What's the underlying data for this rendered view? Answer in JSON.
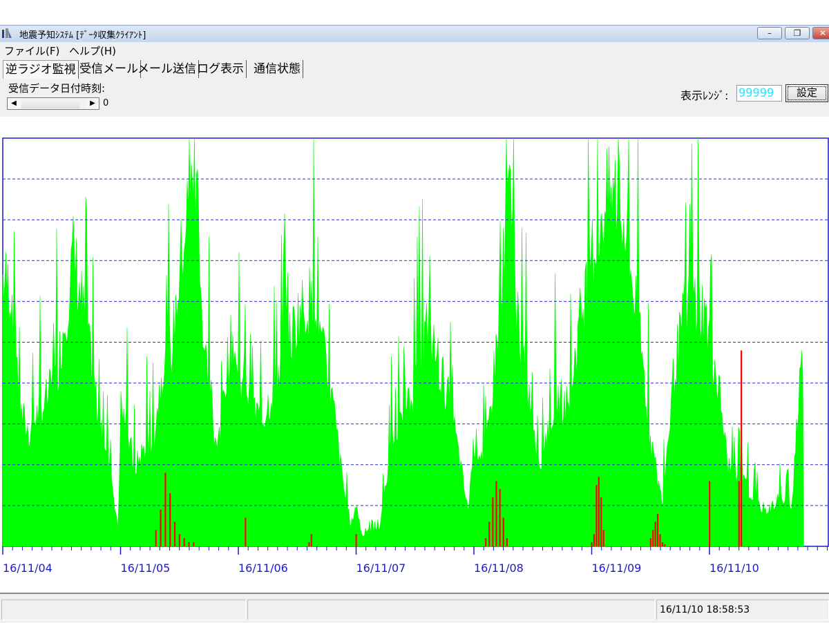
{
  "window": {
    "title": "地震予知ｼｽﾃﾑ [ﾃﾞｰﾀ収集ｸﾗｲｱﾝﾄ]",
    "controls": {
      "minimize": "–",
      "restore": "❐",
      "close": "✕"
    }
  },
  "menu": {
    "items": [
      "ファイル(F)",
      "ヘルプ(H)"
    ]
  },
  "tabs": [
    "逆ラジオ監視",
    "受信メール",
    "メール送信",
    "ログ表示",
    "通信状態"
  ],
  "active_tab": "逆ラジオ監視",
  "toolbar": {
    "date_label": "受信データ日付時刻:",
    "scroll_value": "0",
    "range_label": "表示ﾚﾝｼﾞ:",
    "range_value": "99999",
    "set_button": "設定"
  },
  "status": {
    "left": "",
    "middle": "",
    "datetime": "16/11/10 18:58:53"
  },
  "colors": {
    "signal": "#00ff00",
    "event": "#ff0000",
    "axis": "#1a1acc",
    "grid": "#2a2ad0",
    "range_text": "#27e4ff"
  },
  "icons": {
    "app": "radio-tower-icon",
    "scroll_left": "left-arrow-icon",
    "scroll_right": "right-arrow-icon"
  },
  "chart_data": {
    "type": "area",
    "ylim": [
      0,
      99999
    ],
    "grid": true,
    "x_tick_labels": [
      "16/11/04",
      "16/11/05",
      "16/11/06",
      "16/11/07",
      "16/11/08",
      "16/11/09",
      "16/11/10"
    ],
    "series": [
      {
        "color": "#00ff00",
        "x": [
          0,
          0.08,
          0.15,
          0.22,
          0.3,
          0.38,
          0.46,
          0.54,
          0.6,
          0.7,
          0.8,
          0.9,
          0.98,
          1,
          1.05,
          1.12,
          1.2,
          1.28,
          1.36,
          1.44,
          1.5,
          1.55,
          1.6,
          1.66,
          1.7,
          1.76,
          1.8,
          1.86,
          1.9,
          1.96,
          2,
          2.06,
          2.1,
          2.2,
          2.3,
          2.4,
          2.5,
          2.6,
          2.7,
          2.8,
          2.88,
          2.95,
          3,
          3.05,
          3.1,
          3.2,
          3.3,
          3.4,
          3.5,
          3.6,
          3.7,
          3.8,
          3.9,
          3.95,
          4,
          4.1,
          4.2,
          4.3,
          4.4,
          4.5,
          4.55,
          4.6,
          4.7,
          4.8,
          4.9,
          5,
          5.1,
          5.2,
          5.3,
          5.4,
          5.5,
          5.6,
          5.7,
          5.8,
          5.9,
          6,
          6.1,
          6.15,
          6.2,
          6.3,
          6.4,
          6.5,
          6.6,
          6.7,
          6.78,
          6.8
        ],
        "values": [
          76000,
          72000,
          38000,
          32000,
          38000,
          42000,
          50000,
          68000,
          83000,
          63000,
          40000,
          26000,
          4000,
          40000,
          34000,
          22000,
          28000,
          31000,
          52000,
          57000,
          78000,
          92000,
          100000,
          100000,
          58000,
          45000,
          30000,
          36000,
          52000,
          60000,
          45000,
          48000,
          40000,
          36000,
          45000,
          55000,
          65000,
          70000,
          58000,
          41000,
          20000,
          5000,
          12000,
          3000,
          4000,
          5000,
          30000,
          35000,
          45000,
          62000,
          52000,
          40000,
          20000,
          10000,
          30000,
          25000,
          60000,
          100000,
          55000,
          36000,
          22000,
          30000,
          42000,
          40000,
          64000,
          82000,
          97000,
          100000,
          86000,
          63000,
          30000,
          12000,
          50000,
          68000,
          72000,
          60000,
          40000,
          24000,
          20000,
          18000,
          12000,
          10000,
          14000,
          12000,
          57000,
          57000
        ]
      },
      {
        "color": "#ff0000",
        "x": [
          1.3,
          1.34,
          1.38,
          1.42,
          1.46,
          1.5,
          1.54,
          1.58,
          1.62,
          2.06,
          2.62,
          2.6,
          3.0,
          4.1,
          4.13,
          4.16,
          4.19,
          4.22,
          4.25,
          4.28,
          5.0,
          5.02,
          5.04,
          5.06,
          5.08,
          5.1,
          5.5,
          5.52,
          5.54,
          5.56,
          5.58,
          5.6,
          5.62,
          6.0,
          6.25,
          6.27
        ],
        "values": [
          4000,
          9000,
          18000,
          13000,
          6000,
          3000,
          2000,
          1000,
          1000,
          7000,
          3000,
          1000,
          3000,
          2000,
          6000,
          12000,
          16000,
          14000,
          7000,
          2000,
          1000,
          3000,
          15000,
          17000,
          12000,
          4000,
          2000,
          4000,
          6000,
          8000,
          3000,
          1000,
          500,
          16000,
          16000,
          48000
        ]
      }
    ]
  }
}
